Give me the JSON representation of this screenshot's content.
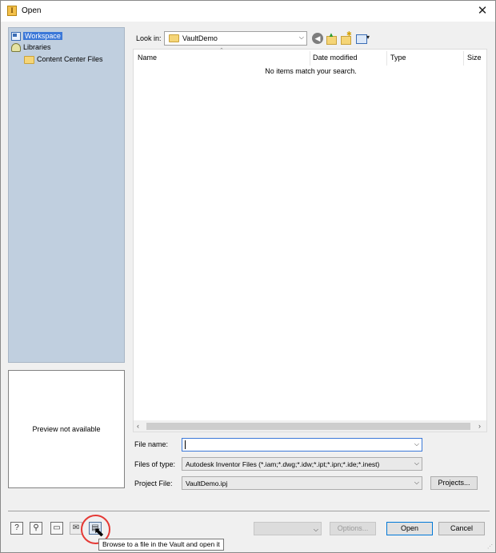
{
  "window": {
    "title": "Open",
    "icon": "inventor-app-icon",
    "close_glyph": "✕"
  },
  "places": [
    {
      "label": "Workspace",
      "icon": "workspace-icon",
      "selected": true
    },
    {
      "label": "Libraries",
      "icon": "libraries-icon",
      "selected": false
    },
    {
      "label": "Content Center Files",
      "icon": "folder-icon",
      "selected": false
    }
  ],
  "preview": {
    "text": "Preview not available"
  },
  "lookin": {
    "label": "Look in:",
    "value": "VaultDemo",
    "toolbar": [
      "back-icon",
      "up-folder-icon",
      "new-folder-icon",
      "view-menu-icon"
    ]
  },
  "filelist": {
    "columns": [
      "Name",
      "Date modified",
      "Type",
      "Size"
    ],
    "empty_message": "No items match your search."
  },
  "fields": {
    "file_name": {
      "label": "File name:",
      "value": ""
    },
    "files_of_type": {
      "label": "Files of type:",
      "value": "Autodesk Inventor Files (*.iam;*.dwg;*.idw;*.ipt;*.ipn;*.ide;*.inest)"
    },
    "project_file": {
      "label": "Project File:",
      "value": "VaultDemo.ipj"
    },
    "projects_button": "Projects..."
  },
  "footer": {
    "options_label": "Options...",
    "open_label": "Open",
    "cancel_label": "Cancel",
    "small_buttons": [
      "help-icon",
      "find-icon",
      "preview-icon",
      "mail-icon",
      "vault-browse-icon"
    ]
  },
  "tooltip": "Browse to a file in the Vault and open it",
  "colors": {
    "selection": "#3b78d8",
    "places_bg": "#c0cfdf",
    "highlight_ring": "#e53935"
  }
}
